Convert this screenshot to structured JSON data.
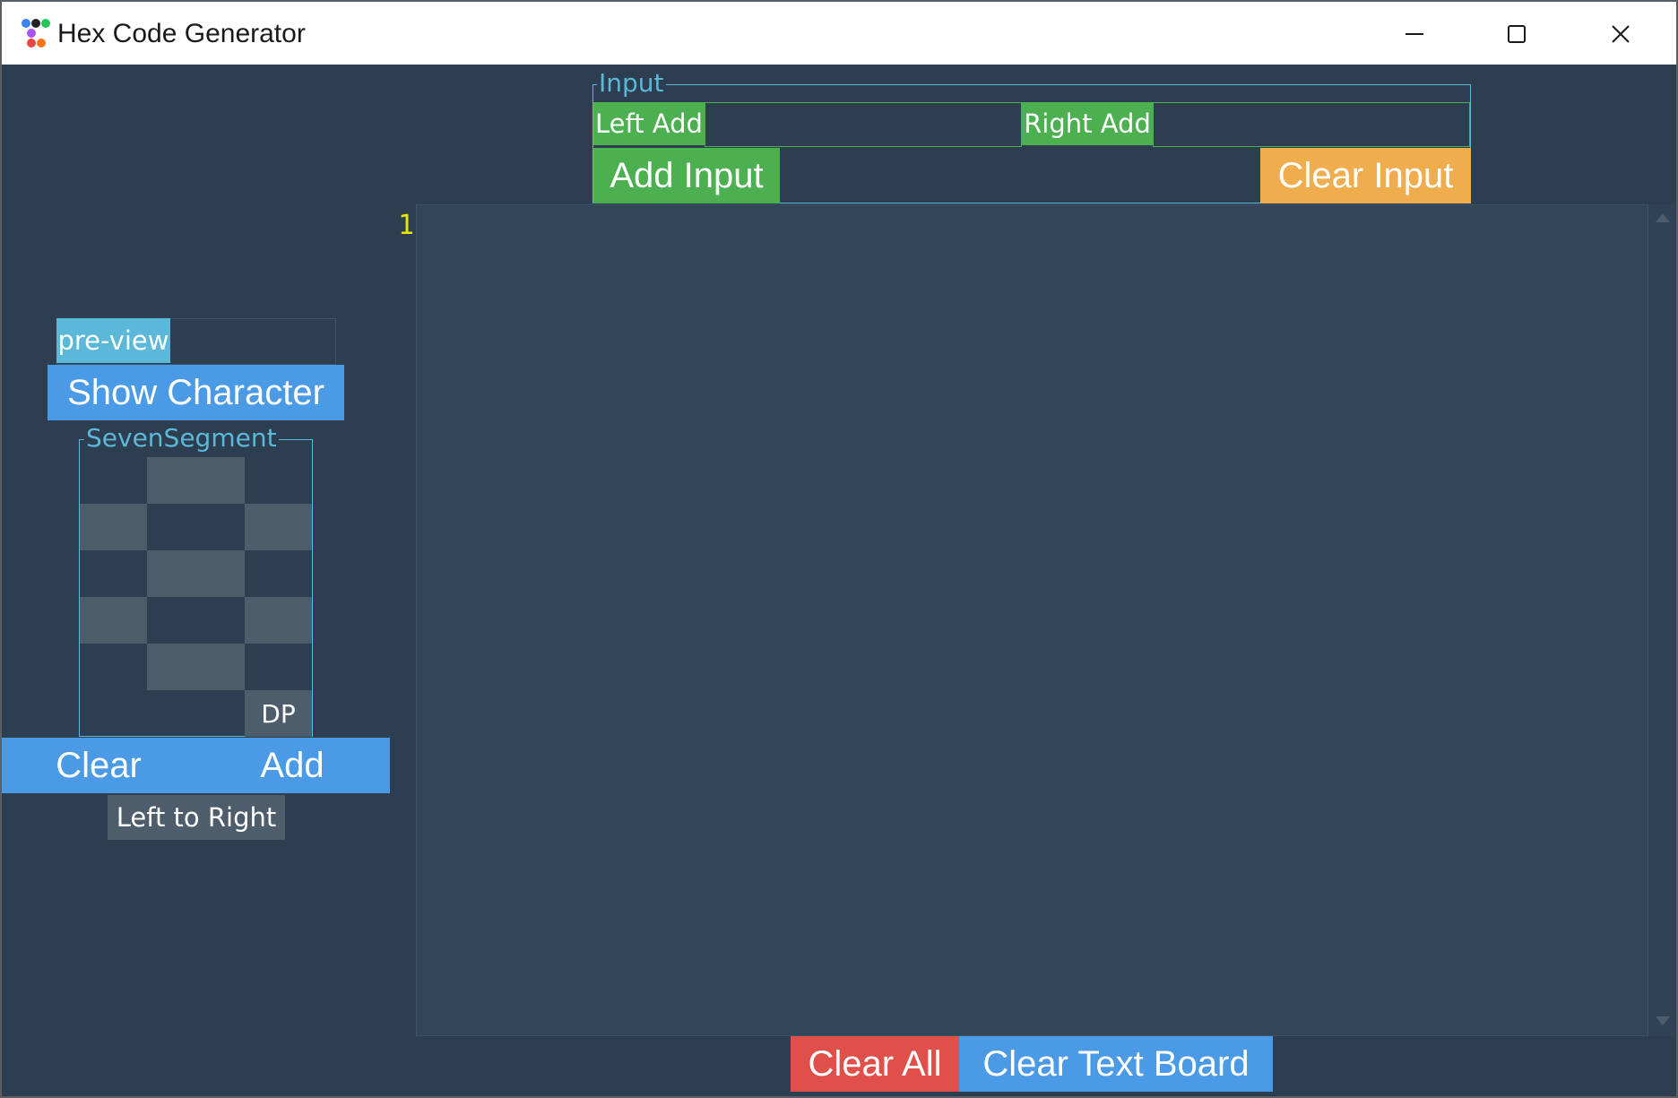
{
  "window": {
    "title": "Hex Code Generator",
    "controls": {
      "minimize": "—",
      "maximize": "☐",
      "close": "✕"
    }
  },
  "input_group": {
    "legend": "Input",
    "left_add_label": "Left Add",
    "left_add_value": "",
    "right_add_label": "Right Add",
    "right_add_value": "",
    "add_input_button": "Add Input",
    "clear_input_button": "Clear Input"
  },
  "preview": {
    "label": "pre-view",
    "value": "",
    "show_character_button": "Show Character"
  },
  "seven_segment": {
    "legend": "SevenSegment",
    "dp_label": "DP"
  },
  "segment_actions": {
    "clear_button": "Clear",
    "add_button": "Add",
    "direction_button": "Left to Right"
  },
  "text_board": {
    "line_number": "1",
    "content": ""
  },
  "bottom_actions": {
    "clear_all_button": "Clear All",
    "clear_text_board_button": "Clear Text Board"
  },
  "colors": {
    "background": "#2c3e50",
    "green": "#4caf50",
    "blue": "#4a9ae6",
    "orange": "#f0ad4e",
    "red": "#e0504a",
    "group_border": "#5bb8d8",
    "segment_off": "#4e5d6c",
    "line_number": "#e6e600"
  },
  "icons": {
    "app": "palette-dots-icon",
    "scroll_up": "scroll-up-arrow-icon",
    "scroll_down": "scroll-down-arrow-icon"
  }
}
